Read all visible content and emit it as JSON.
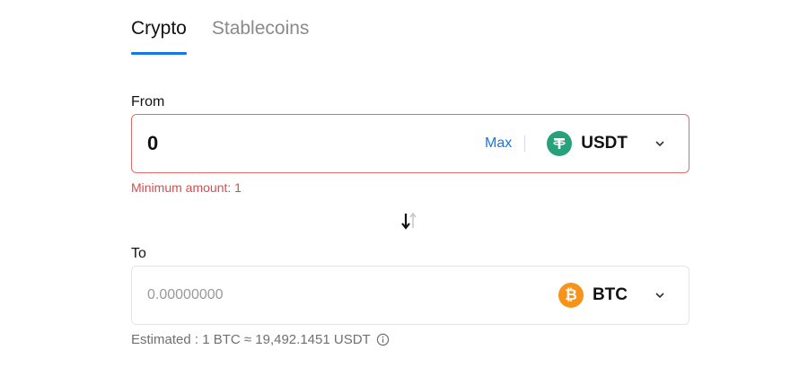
{
  "tabs": [
    {
      "label": "Crypto",
      "active": true
    },
    {
      "label": "Stablecoins",
      "active": false
    }
  ],
  "from": {
    "label": "From",
    "amount": "0",
    "max_label": "Max",
    "coin": "USDT",
    "coin_icon": "tether-icon",
    "coin_color": "#26a17b",
    "error": "Minimum amount: 1"
  },
  "to": {
    "label": "To",
    "placeholder": "0.00000000",
    "coin": "BTC",
    "coin_icon": "bitcoin-icon",
    "coin_color": "#f7931a"
  },
  "estimate": {
    "text": "Estimated : 1 BTC ≈ 19,492.1451 USDT"
  },
  "colors": {
    "accent": "#1677e6",
    "error": "#d94c4c",
    "error_border": "#e06c6c"
  }
}
